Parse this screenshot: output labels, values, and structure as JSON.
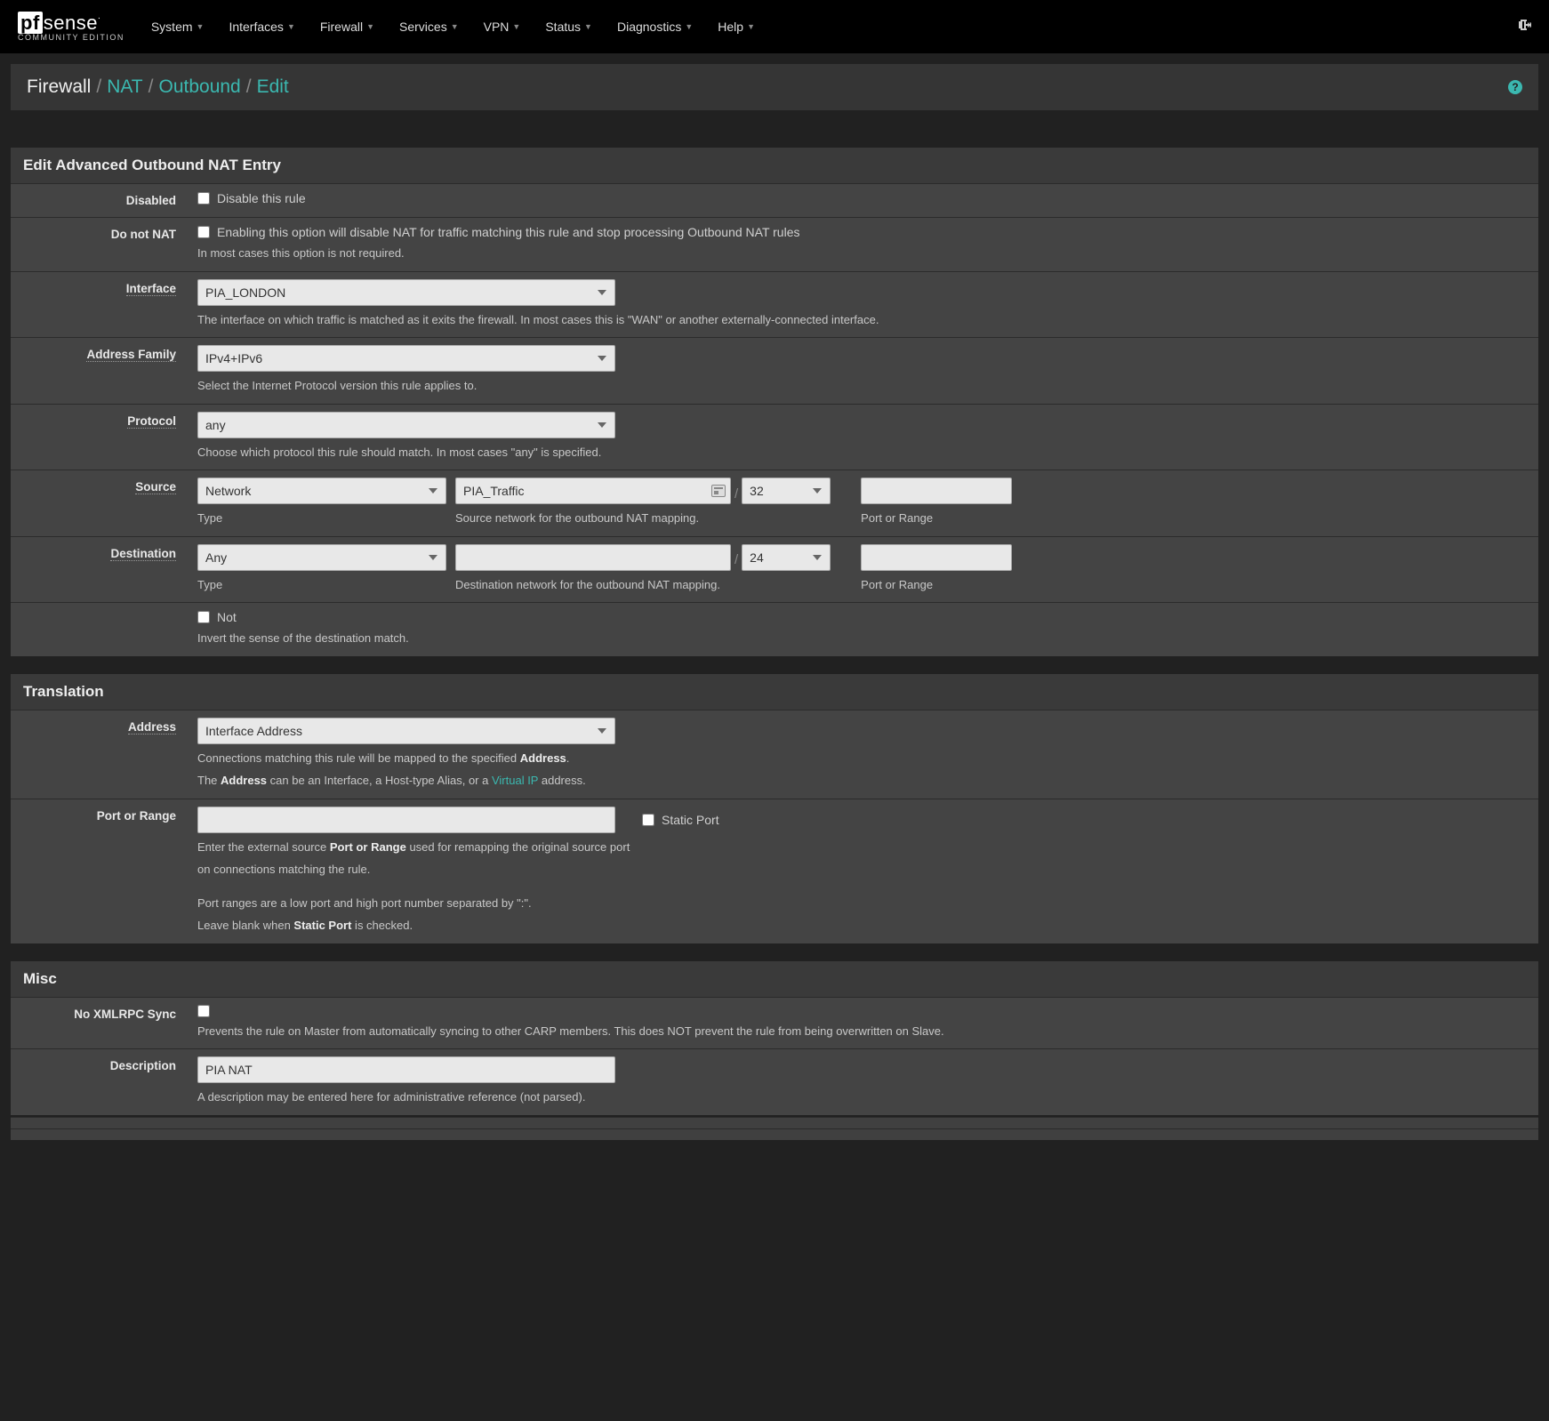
{
  "logo": {
    "pf": "pf",
    "sense": "sense",
    "sub": "COMMUNITY EDITION"
  },
  "nav": [
    "System",
    "Interfaces",
    "Firewall",
    "Services",
    "VPN",
    "Status",
    "Diagnostics",
    "Help"
  ],
  "breadcrumb": {
    "a": "Firewall",
    "b": "NAT",
    "c": "Outbound",
    "d": "Edit",
    "sep": "/"
  },
  "panel1_title": "Edit Advanced Outbound NAT Entry",
  "labels": {
    "disabled": "Disabled",
    "donotnat": "Do not NAT",
    "interface": "Interface",
    "addrfam": "Address Family",
    "protocol": "Protocol",
    "source": "Source",
    "destination": "Destination",
    "address": "Address",
    "portrange": "Port or Range",
    "noxml": "No XMLRPC Sync",
    "description": "Description"
  },
  "disabled_chk": "Disable this rule",
  "donotnat_chk": "Enabling this option will disable NAT for traffic matching this rule and stop processing Outbound NAT rules",
  "donotnat_help": "In most cases this option is not required.",
  "interface_val": "PIA_LONDON",
  "interface_help": "The interface on which traffic is matched as it exits the firewall. In most cases this is \"WAN\" or another externally-connected interface.",
  "addrfam_val": "IPv4+IPv6",
  "addrfam_help": "Select the Internet Protocol version this rule applies to.",
  "protocol_val": "any",
  "protocol_help": "Choose which protocol this rule should match. In most cases \"any\" is specified.",
  "src_type": "Network",
  "src_net": "PIA_Traffic",
  "src_mask": "32",
  "src_help_type": "Type",
  "src_help_net": "Source network for the outbound NAT mapping.",
  "src_help_port": "Port or Range",
  "dst_type": "Any",
  "dst_net": "",
  "dst_mask": "24",
  "dst_help_type": "Type",
  "dst_help_net": "Destination network for the outbound NAT mapping.",
  "dst_help_port": "Port or Range",
  "not_label": "Not",
  "not_help": "Invert the sense of the destination match.",
  "panel2_title": "Translation",
  "trans_addr": "Interface Address",
  "trans_help1_a": "Connections matching this rule will be mapped to the specified ",
  "trans_help1_b": "Address",
  "trans_help1_c": ".",
  "trans_help2_a": "The ",
  "trans_help2_b": "Address",
  "trans_help2_c": " can be an Interface, a Host-type Alias, or a ",
  "trans_help2_link": "Virtual IP",
  "trans_help2_d": " address.",
  "staticport": "Static Port",
  "port_help1_a": "Enter the external source ",
  "port_help1_b": "Port or Range",
  "port_help1_c": " used for remapping the original source port",
  "port_help1_d": "on connections matching the rule.",
  "port_help2": "Port ranges are a low port and high port number separated by \":\".",
  "port_help3_a": "Leave blank when ",
  "port_help3_b": "Static Port",
  "port_help3_c": " is checked.",
  "panel3_title": "Misc",
  "noxml_help": "Prevents the rule on Master from automatically syncing to other CARP members. This does NOT prevent the rule from being overwritten on Slave.",
  "desc_val": "PIA NAT",
  "desc_help": "A description may be entered here for administrative reference (not parsed)."
}
